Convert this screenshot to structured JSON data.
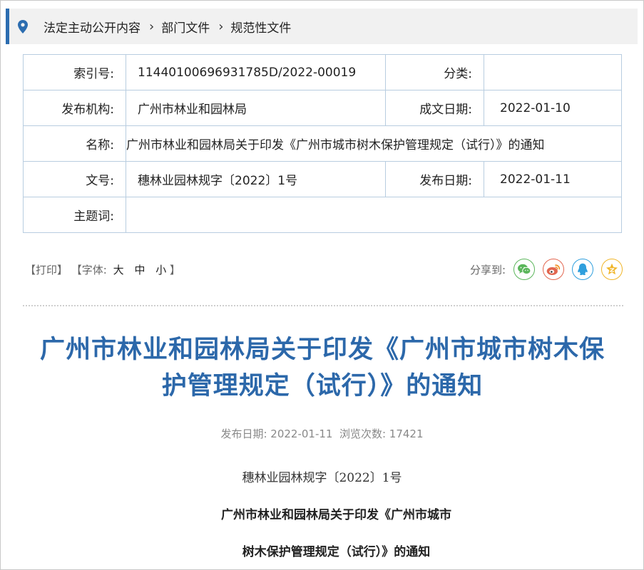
{
  "breadcrumb": {
    "items": [
      "法定主动公开内容",
      "部门文件",
      "规范性文件"
    ],
    "separator": "›"
  },
  "meta": {
    "index_no": {
      "label": "索引号:",
      "value": "11440100696931785D/2022-00019"
    },
    "category": {
      "label": "分类:",
      "value": ""
    },
    "publisher": {
      "label": "发布机构:",
      "value": "广州市林业和园林局"
    },
    "created_date": {
      "label": "成文日期:",
      "value": "2022-01-10"
    },
    "name": {
      "label": "名称:",
      "value": "广州市林业和园林局关于印发《广州市城市树木保护管理规定（试行）》的通知"
    },
    "doc_no": {
      "label": "文号:",
      "value": "穗林业园林规字〔2022〕1号"
    },
    "publish_date": {
      "label": "发布日期:",
      "value": "2022-01-11"
    },
    "keywords": {
      "label": "主题词:",
      "value": ""
    }
  },
  "tools": {
    "print": "【打印】",
    "font_open": "【字体:",
    "large": "大",
    "medium": "中",
    "small": "小",
    "font_close": "】"
  },
  "share": {
    "label": "分享到:",
    "icons": [
      "wechat-icon",
      "weibo-icon",
      "qq-icon",
      "qzone-icon"
    ]
  },
  "article": {
    "title_line1": "广州市林业和园林局关于印发《广州市城市树木保",
    "title_line2": "护管理规定（试行）》的通知",
    "publish_info": "发布日期: 2022-01-11  浏览次数: 17421",
    "doc_no": "穗林业园林规字〔2022〕1号",
    "body_title_line1": "广州市林业和园林局关于印发《广州市城市",
    "body_title_line2": "树木保护管理规定（试行）》的通知"
  },
  "colors": {
    "accent": "#2c6db0",
    "title": "#2c68aa",
    "wechat": "#5bb65b",
    "weibo": "#e2664f",
    "qq": "#2f9fdd",
    "qzone": "#f0b528"
  }
}
